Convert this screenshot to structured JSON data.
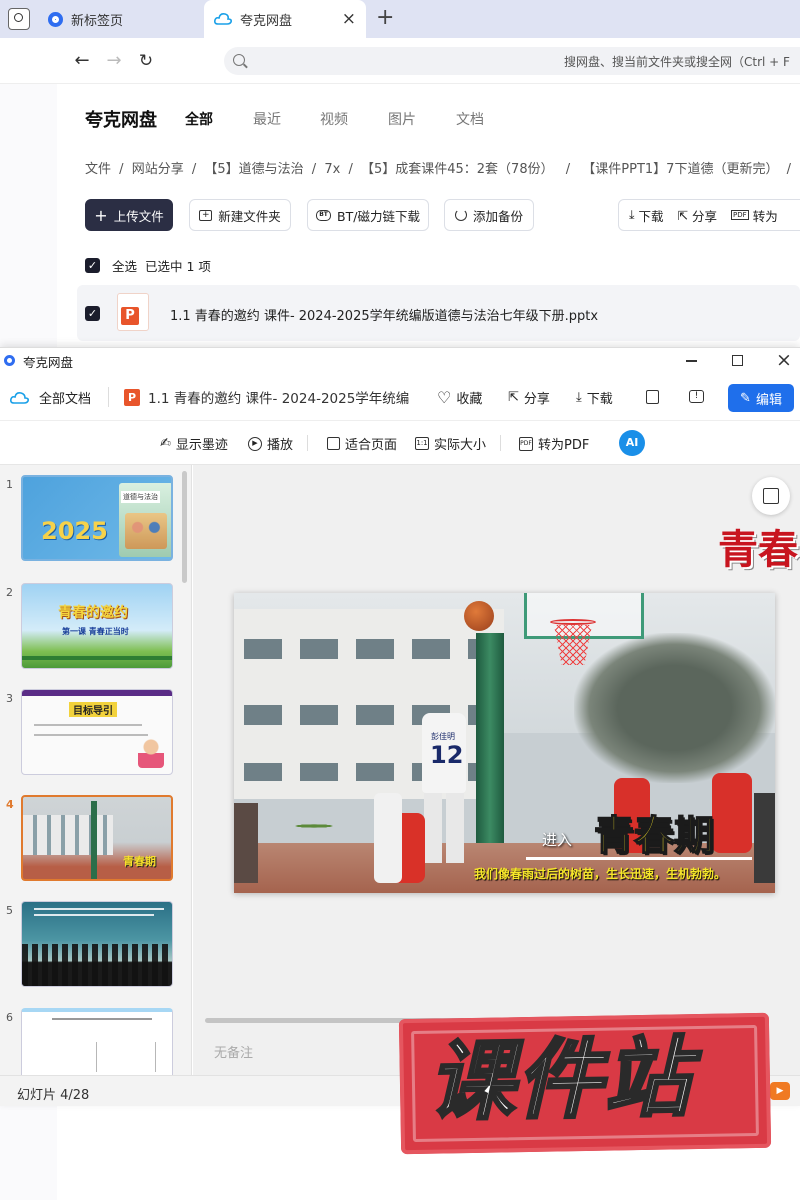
{
  "browser": {
    "tabs": [
      {
        "label": "新标签页"
      },
      {
        "label": "夸克网盘"
      }
    ],
    "new_tab": "+",
    "close": "×",
    "address_placeholder": "搜网盘、搜当前文件夹或搜全网（Ctrl + F"
  },
  "disk": {
    "brand": "夸克网盘",
    "nav": [
      "全部",
      "最近",
      "视频",
      "图片",
      "文档"
    ],
    "breadcrumb": [
      "文件",
      "网站分享",
      "【5】道德与法治",
      "7x",
      "【5】成套课件45：2套（78份）",
      "【课件PPT1】7下道德（更新完）"
    ],
    "sep": "/",
    "actions": {
      "upload": "上传文件",
      "new_folder": "新建文件夹",
      "bt": "BT/磁力链下载",
      "backup": "添加备份",
      "download": "下载",
      "share": "分享",
      "convert": "转为"
    },
    "select_all": "全选",
    "selected_info": "已选中 1 项",
    "file_name": "1.1 青春的邀约 课件- 2024-2025学年统编版道德与法治七年级下册.pptx"
  },
  "viewer": {
    "title": "夸克网盘",
    "all_docs": "全部文档",
    "doc_title": "1.1 青春的邀约 课件- 2024-2025学年统编",
    "favorite": "收藏",
    "share": "分享",
    "download": "下载",
    "edit": "编辑",
    "toolbar": {
      "ink": "显示墨迹",
      "play": "播放",
      "fit": "适合页面",
      "actual": "实际大小",
      "to_pdf": "转为PDF"
    },
    "thumbnails": [
      {
        "num": "1",
        "text": "2025",
        "badge": "道德与法治"
      },
      {
        "num": "2",
        "text": "青春的邀约",
        "sub": "第一课 青春正当时"
      },
      {
        "num": "3",
        "text": "目标导引"
      },
      {
        "num": "4",
        "text": "青春期"
      },
      {
        "num": "5"
      },
      {
        "num": "6"
      }
    ],
    "current_slide": "4",
    "slide": {
      "enter": "进入",
      "title": "青春期",
      "subtitle": "我们像春雨过后的树苗，生长迅速，生机勃勃。",
      "jersey": "12",
      "jersey_name": "彭佳明",
      "side_title": "青春"
    },
    "notes": "无备注",
    "status": "幻灯片 4/28",
    "zoom": "%"
  },
  "watermark": "课件站",
  "colors": {
    "primary": "#1f6feb",
    "dark_button": "#2b2e44",
    "thumb_selected": "#e07a2e",
    "red_stamp": "#d93a45"
  }
}
